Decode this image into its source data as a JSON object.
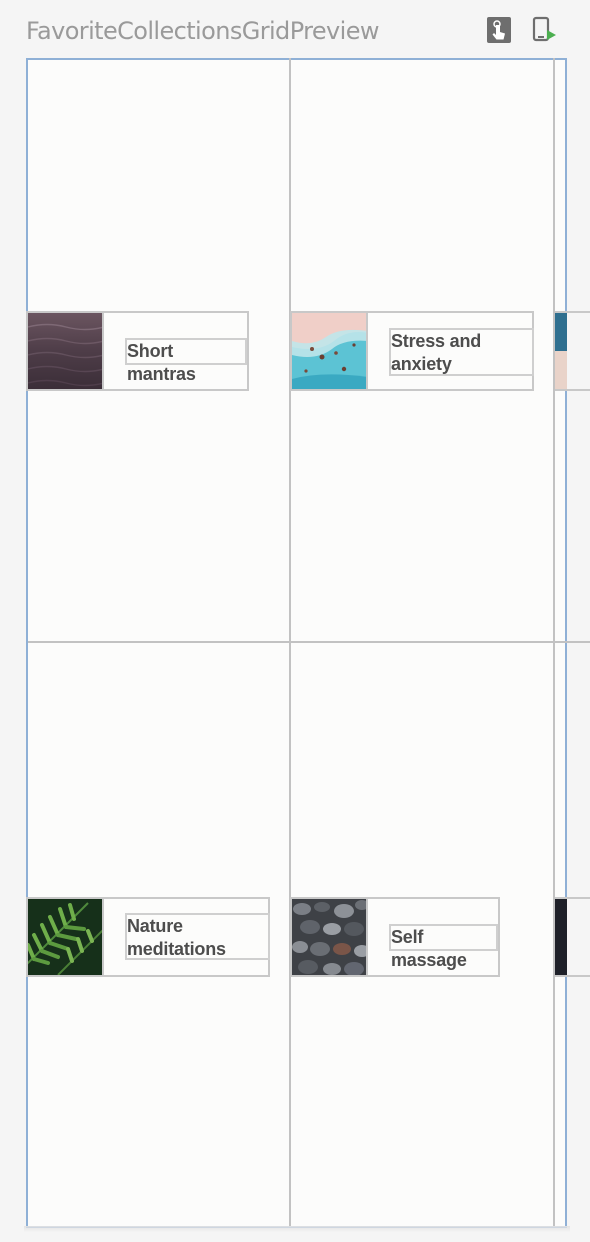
{
  "preview": {
    "title": "FavoriteCollectionsGridPreview"
  },
  "collections": [
    {
      "label": "Short mantras",
      "image": "ocean-water-image"
    },
    {
      "label": "Stress and anxiety",
      "image": "aerial-beach-image"
    },
    {
      "label": "Nature meditations",
      "image": "fern-leaves-image"
    },
    {
      "label": "Self massage",
      "image": "pebbles-image"
    }
  ],
  "colors": {
    "frame_border": "#8fb0d6",
    "grid_line": "#c2c2c2",
    "label_text": "#4d4d4d",
    "title_text": "#9a9a9a",
    "deploy_accent": "#4caf50"
  }
}
